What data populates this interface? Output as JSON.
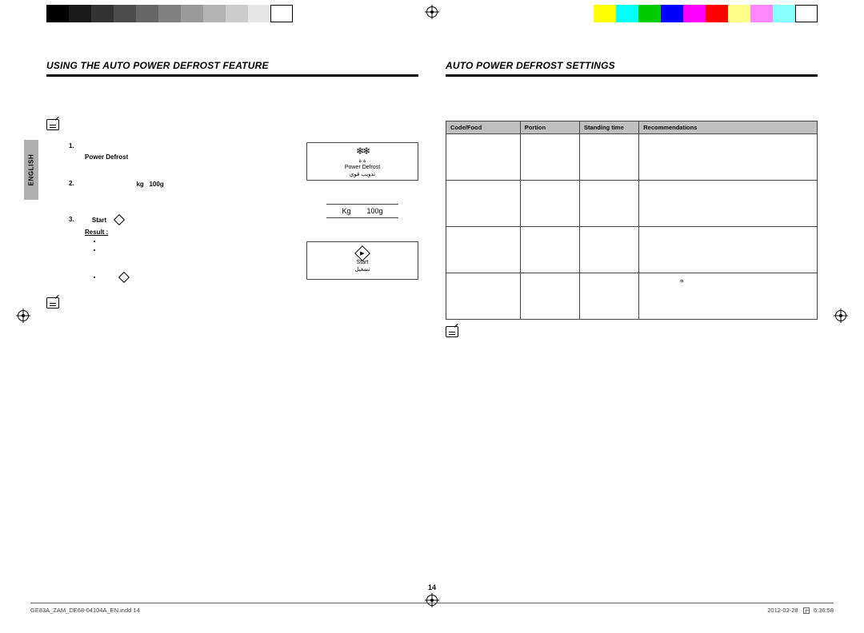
{
  "sideTab": "ENGLISH",
  "left": {
    "heading": "USING THE AUTO POWER DEFROST FEATURE",
    "steps": {
      "s1": {
        "num": "1.",
        "label": "Power Defrost"
      },
      "s2": {
        "num": "2.",
        "kg": "kg",
        "g": "100g"
      },
      "s3": {
        "num": "3.",
        "label": "Start",
        "result": "Result :"
      }
    },
    "display": {
      "d1_icon": "❄❄",
      "d1_sub": "ة ة",
      "d1_label": "Power Defrost",
      "d1_ar": "تذويب قوي",
      "d2_kg": "Kg",
      "d2_g": "100g",
      "d3_label": "Start",
      "d3_ar": "تشغيل"
    }
  },
  "right": {
    "heading": "AUTO POWER DEFROST SETTINGS",
    "headers": {
      "h1": "Code/Food",
      "h2": "Portion",
      "h3": "Standing time",
      "h4": "Recommendations"
    }
  },
  "pageNum": "14",
  "footer": {
    "file": "GE83A_ZAM_DE68-04104A_EN.indd   14",
    "date": "2012-02-28",
    "time": "6:36:58"
  }
}
